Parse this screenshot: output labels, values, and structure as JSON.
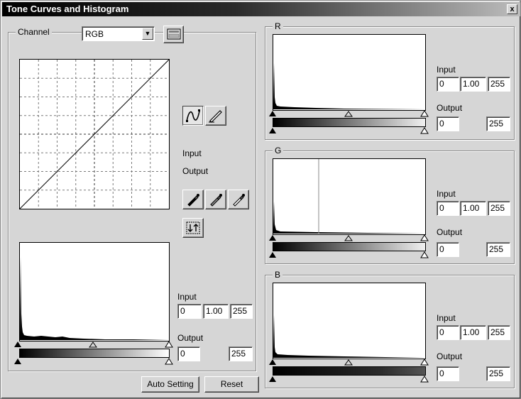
{
  "window": {
    "title": "Tone Curves and Histogram",
    "close_glyph": "x"
  },
  "channel": {
    "label": "Channel",
    "selected": "RGB",
    "options": [
      "RGB"
    ]
  },
  "tools": {
    "curve_mode": "curve-icon",
    "freehand_mode": "pencil-icon",
    "eyedroppers": [
      "black-eyedropper-icon",
      "gray-eyedropper-icon",
      "white-eyedropper-icon"
    ],
    "swap": "swap-arrows-icon"
  },
  "readout": {
    "input_label": "Input",
    "output_label": "Output"
  },
  "master": {
    "input_label": "Input",
    "input_black": "0",
    "input_gamma": "1.00",
    "input_white": "255",
    "output_label": "Output",
    "output_black": "0",
    "output_white": "255"
  },
  "channels": [
    {
      "label": "R",
      "input_label": "Input",
      "input_black": "0",
      "input_gamma": "1.00",
      "input_white": "255",
      "output_label": "Output",
      "output_black": "0",
      "output_white": "255",
      "gradient_end": "#ff0000"
    },
    {
      "label": "G",
      "input_label": "Input",
      "input_black": "0",
      "input_gamma": "1.00",
      "input_white": "255",
      "output_label": "Output",
      "output_black": "0",
      "output_white": "255",
      "gradient_end": "#00ff00"
    },
    {
      "label": "B",
      "input_label": "Input",
      "input_black": "0",
      "input_gamma": "1.00",
      "input_white": "255",
      "output_label": "Output",
      "output_black": "0",
      "output_white": "255",
      "gradient_end": "#0000ff"
    }
  ],
  "buttons": {
    "auto_setting": "Auto Setting",
    "reset": "Reset"
  },
  "colors": {
    "face": "#d6d6d6",
    "title_start": "#000000",
    "title_end": "#bdbdbd"
  }
}
